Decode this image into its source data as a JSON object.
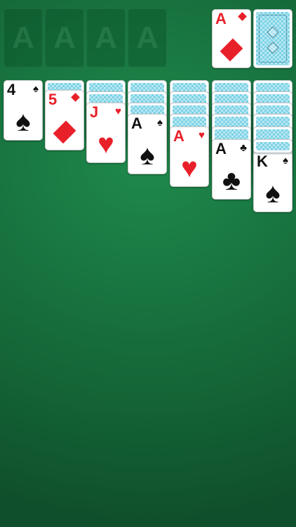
{
  "foundations": [
    {
      "label": "A"
    },
    {
      "label": "A"
    },
    {
      "label": "A"
    },
    {
      "label": "A"
    }
  ],
  "waste": {
    "rank": "A",
    "suit": "diamonds",
    "color": "red"
  },
  "stock": {
    "face_down": true
  },
  "tableau": [
    {
      "hidden_count": 0,
      "top": {
        "rank": "4",
        "suit": "spades",
        "color": "black"
      }
    },
    {
      "hidden_count": 1,
      "top": {
        "rank": "5",
        "suit": "diamonds",
        "color": "red"
      }
    },
    {
      "hidden_count": 2,
      "top": {
        "rank": "J",
        "suit": "hearts",
        "color": "red"
      }
    },
    {
      "hidden_count": 3,
      "top": {
        "rank": "A",
        "suit": "spades",
        "color": "black"
      }
    },
    {
      "hidden_count": 4,
      "top": {
        "rank": "A",
        "suit": "hearts",
        "color": "red"
      }
    },
    {
      "hidden_count": 5,
      "top": {
        "rank": "A",
        "suit": "clubs",
        "color": "black"
      }
    },
    {
      "hidden_count": 5,
      "top": {
        "rank": "K",
        "suit": "spades",
        "color": "black"
      }
    }
  ],
  "colors": {
    "felt": "#17703d",
    "red_suit": "#e8202a",
    "black_suit": "#111111",
    "card_back": "#7dd3e6"
  }
}
